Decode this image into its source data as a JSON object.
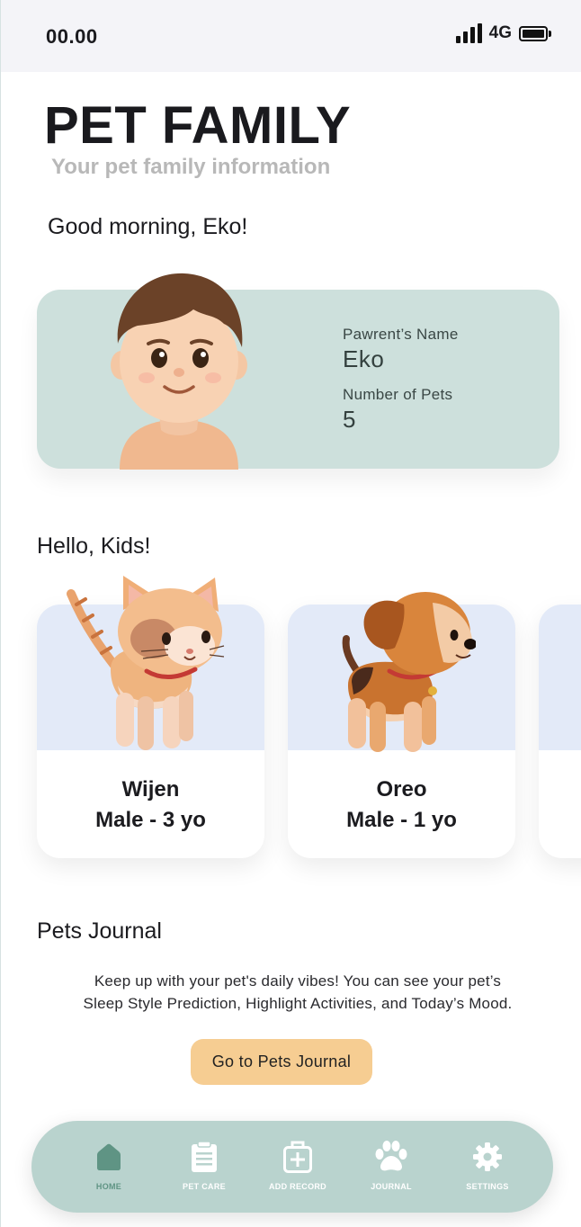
{
  "status_bar": {
    "time": "00.00",
    "network": "4G"
  },
  "header": {
    "title": "PET FAMILY",
    "subtitle": "Your pet family information"
  },
  "greeting": "Good morning, Eko!",
  "owner_card": {
    "avatar_icon": "boy-avatar-illustration",
    "name_label": "Pawrent’s Name",
    "name_value": "Eko",
    "pets_label": "Number of Pets",
    "pets_value": "5",
    "background_color": "#cde0dc"
  },
  "kids_section": {
    "heading": "Hello, Kids!",
    "pets": [
      {
        "name": "Wijen",
        "meta": "Male - 3 yo",
        "illustration": "cat-illustration"
      },
      {
        "name": "Oreo",
        "meta": "Male - 1 yo",
        "illustration": "beagle-dog-illustration"
      }
    ]
  },
  "journal_section": {
    "heading": "Pets Journal",
    "description_line1": "Keep up with your pet's daily vibes! You can see your pet’s",
    "description_line2": "Sleep Style Prediction, Highlight Activities, and Today’s Mood.",
    "button_label": "Go to Pets Journal",
    "button_color": "#f6cd92"
  },
  "bottom_nav": {
    "background_color": "#b9d3ce",
    "active_color": "#5f9484",
    "items": [
      {
        "label": "HOME",
        "icon": "home-icon",
        "active": true
      },
      {
        "label": "PET CARE",
        "icon": "clipboard-icon",
        "active": false
      },
      {
        "label": "ADD RECORD",
        "icon": "first-aid-kit-icon",
        "active": false
      },
      {
        "label": "JOURNAL",
        "icon": "paw-icon",
        "active": false
      },
      {
        "label": "SETTINGS",
        "icon": "gear-icon",
        "active": false
      }
    ]
  }
}
